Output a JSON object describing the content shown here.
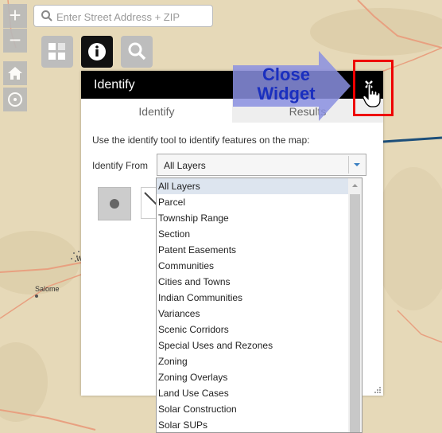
{
  "search": {
    "placeholder": "Enter Street Address + ZIP"
  },
  "map": {
    "zoom_in_label": "+",
    "zoom_out_label": "−",
    "place_labels": {
      "salome": "Salome",
      "w_fragment": "W"
    }
  },
  "toolbar": {
    "layers_icon": "layers-grid-icon",
    "identify_icon": "info-icon",
    "search_icon": "search-icon"
  },
  "panel": {
    "title": "Identify",
    "tabs": [
      "Identify",
      "Results"
    ],
    "instructions": "Use the identify tool to identify features on the map:",
    "identify_from_label": "Identify From",
    "selected_layer": "All Layers"
  },
  "dropdown": {
    "options": [
      "All Layers",
      "Parcel",
      "Township Range",
      "Section",
      "Patent Easements",
      "Communities",
      "Cities and Towns",
      "Indian Communities",
      "Variances",
      "Scenic Corridors",
      "Special Uses and Rezones",
      "Zoning",
      "Zoning Overlays",
      "Land Use Cases",
      "Solar Construction",
      "Solar SUPs"
    ],
    "selected_index": 0
  },
  "annotation": {
    "callout_text": "Close Widget",
    "close_symbol": "✕"
  },
  "colors": {
    "panel_header": "#000000",
    "callout_arrow": "#8a8fe0",
    "callout_text": "#1a2fbf",
    "highlight_box": "#e00000",
    "map_base": "#e6d9b8"
  }
}
